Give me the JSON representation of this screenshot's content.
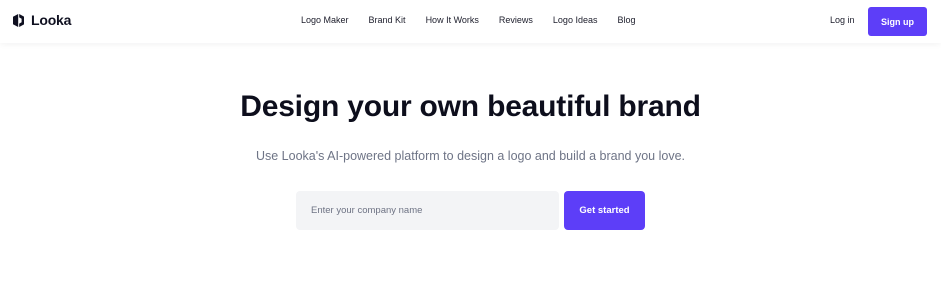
{
  "header": {
    "brand": {
      "name": "Looka",
      "icon": "looka-logo-icon"
    },
    "nav": [
      "Logo Maker",
      "Brand Kit",
      "How It Works",
      "Reviews",
      "Logo Ideas",
      "Blog"
    ],
    "login_label": "Log in",
    "signup_label": "Sign up"
  },
  "hero": {
    "title": "Design your own beautiful brand",
    "subtitle": "Use Looka's AI-powered platform to design a logo and build a brand you love.",
    "input": {
      "value": "",
      "placeholder": "Enter your company name"
    },
    "cta_label": "Get started"
  },
  "colors": {
    "accent": "#5d3ef8",
    "heading": "#0d0e1c",
    "subtitle": "#6e7486",
    "input_bg": "#f3f4f6"
  }
}
